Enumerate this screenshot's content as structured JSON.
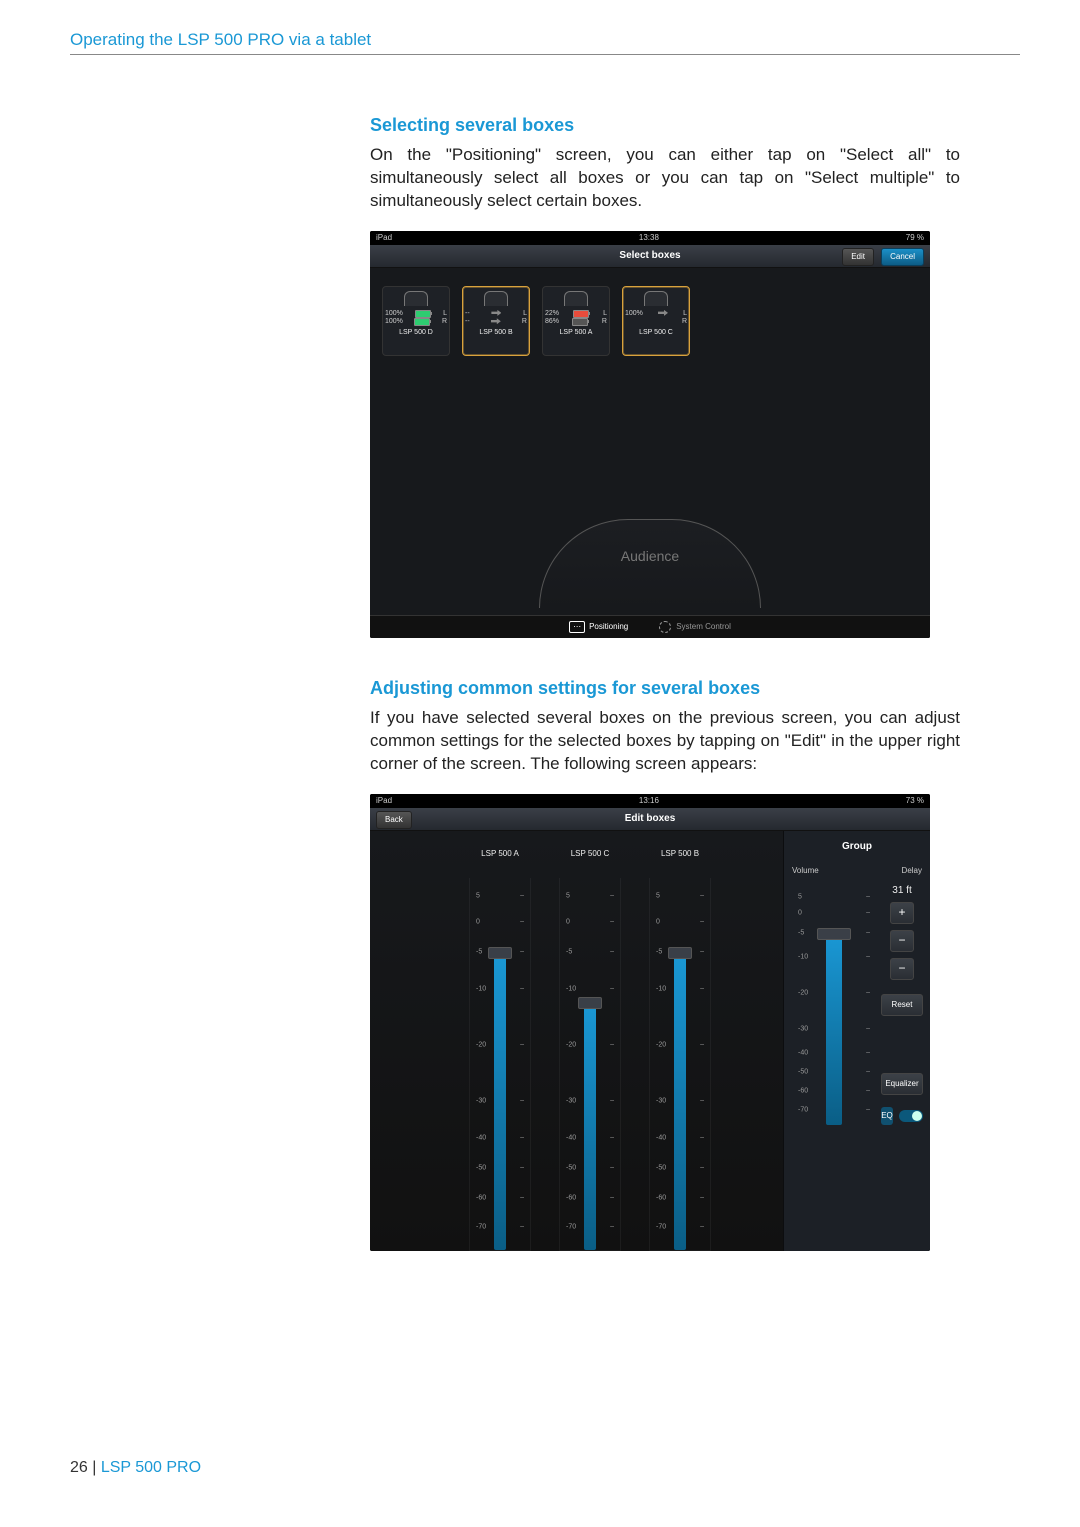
{
  "header": "Operating the LSP 500 PRO via a tablet",
  "section1": {
    "title": "Selecting several boxes",
    "paragraph": "On the \"Positioning\" screen, you can either tap on \"Select all\" to simultaneously select all boxes or you can tap on \"Select multiple\" to simultaneously select certain boxes."
  },
  "section2": {
    "title": "Adjusting common settings for several boxes",
    "paragraph": "If you have selected several boxes on the previous screen, you can adjust common settings for the selected boxes by tapping on \"Edit\" in the upper right corner of the screen. The following screen appears:"
  },
  "footer": {
    "page": "26",
    "sep": " | ",
    "product": "LSP 500 PRO"
  },
  "ss1": {
    "status": {
      "device": "iPad",
      "time": "13:38",
      "battery": "79 %"
    },
    "title": "Select boxes",
    "edit": "Edit",
    "cancel": "Cancel",
    "boxes": [
      {
        "name": "LSP 500 D",
        "l": "100%",
        "r": "100%",
        "battL": "green",
        "battR": "green",
        "selected": false
      },
      {
        "name": "LSP 500 B",
        "l": "--",
        "r": "--",
        "battL": "plug",
        "battR": "plug",
        "selected": true
      },
      {
        "name": "LSP 500 A",
        "l": "22%",
        "r": "86%",
        "battL": "red",
        "battR": "grey",
        "selected": false
      },
      {
        "name": "LSP 500 C",
        "l": "100%",
        "r": "",
        "battL": "plug",
        "battR": "none",
        "selected": true
      }
    ],
    "audience": "Audience",
    "tabs": {
      "positioning": "Positioning",
      "system": "System Control"
    }
  },
  "ss2": {
    "status": {
      "device": "iPad",
      "time": "13:16",
      "battery": "73 %"
    },
    "title": "Edit boxes",
    "back": "Back",
    "faders": [
      {
        "name": "LSP 500 A",
        "level": -10
      },
      {
        "name": "LSP 500 C",
        "level": -20
      },
      {
        "name": "LSP 500 B",
        "level": -10
      }
    ],
    "scale_ticks": [
      "5",
      "0",
      "-5",
      "-10",
      "-20",
      "-30",
      "-40",
      "-50",
      "-60",
      "-70"
    ],
    "scale_positions": [
      5,
      12,
      20,
      30,
      45,
      60,
      70,
      78,
      86,
      94
    ],
    "group": {
      "title": "Group",
      "volume": "Volume",
      "delay": "Delay",
      "delay_value": "31 ft",
      "level": -10,
      "reset": "Reset",
      "equalizer": "Equalizer",
      "eq": "EQ"
    }
  }
}
